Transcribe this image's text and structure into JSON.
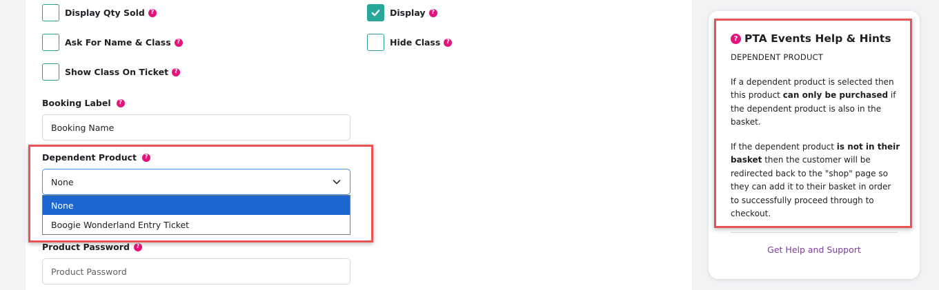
{
  "options": {
    "display_qty_sold": {
      "label": "Display Qty Sold",
      "checked": false
    },
    "display": {
      "label": "Display",
      "checked": true
    },
    "ask_name_class": {
      "label": "Ask For Name & Class",
      "checked": false
    },
    "hide_class": {
      "label": "Hide Class",
      "checked": false
    },
    "show_class_ticket": {
      "label": "Show Class On Ticket",
      "checked": false
    }
  },
  "help_icon_glyph": "?",
  "booking_label": {
    "label": "Booking Label",
    "value": "Booking Name"
  },
  "dependent_product": {
    "label": "Dependent Product",
    "selected": "None",
    "options": [
      "None",
      "Boogie Wonderland Entry Ticket"
    ]
  },
  "product_password": {
    "label": "Product Password",
    "placeholder": "Product Password"
  },
  "help": {
    "title": "PTA Events Help & Hints",
    "subtitle": "DEPENDENT PRODUCT",
    "p1_a": "If a dependent product is selected then this product ",
    "p1_b": "can only be purchased",
    "p1_c": " if the dependent product is also in the basket.",
    "p2_a": "If the dependent product ",
    "p2_b": "is not in their basket",
    "p2_c": " then the customer will be redirected back to the \"shop\" page so they can add it to their basket in order to successfully proceed through to checkout.",
    "support_link": "Get Help and Support"
  },
  "colors": {
    "accent_teal": "#27a69a",
    "help_pink": "#e5137b",
    "highlight_red": "#e85454",
    "dropdown_selected": "#1b66d1",
    "link_purple": "#7d3c98"
  }
}
